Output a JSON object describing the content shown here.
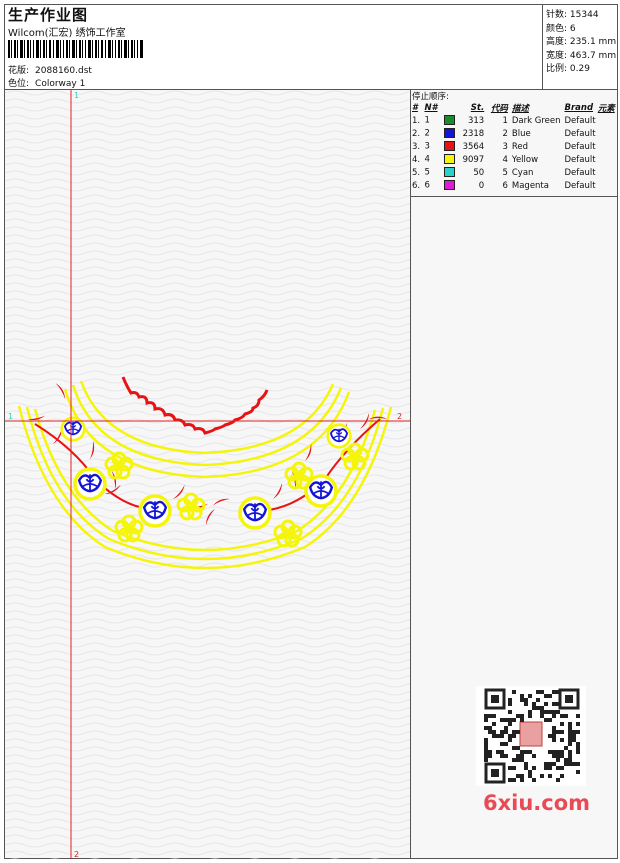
{
  "header": {
    "title": "生产作业图",
    "company": "Wilcom(汇宏) 绣饰工作室",
    "design_label": "花版:",
    "design_file": "2088160.dst",
    "colorway_label": "色位:",
    "colorway": "Colorway 1"
  },
  "stats": [
    {
      "label": "针数:",
      "value": "15344"
    },
    {
      "label": "颜色:",
      "value": "6"
    },
    {
      "label": "高度:",
      "value": "235.1 mm"
    },
    {
      "label": "宽度:",
      "value": "463.7 mm"
    },
    {
      "label": "比例:",
      "value": "0.29"
    }
  ],
  "stop_panel": {
    "title": "停止顺序:",
    "columns": [
      "#",
      "N#",
      "St.",
      "代码",
      "描述",
      "Brand",
      "元素"
    ],
    "rows": [
      {
        "num": "1.",
        "n": "1",
        "color": "#1e8a2e",
        "st": "313",
        "code": "1",
        "desc": "Dark Green",
        "brand": "Default"
      },
      {
        "num": "2.",
        "n": "2",
        "color": "#1414d8",
        "st": "2318",
        "code": "2",
        "desc": "Blue",
        "brand": "Default"
      },
      {
        "num": "3.",
        "n": "3",
        "color": "#e81414",
        "st": "3564",
        "code": "3",
        "desc": "Red",
        "brand": "Default"
      },
      {
        "num": "4.",
        "n": "4",
        "color": "#f5f50a",
        "st": "9097",
        "code": "4",
        "desc": "Yellow",
        "brand": "Default"
      },
      {
        "num": "5.",
        "n": "5",
        "color": "#2ad3c8",
        "st": "50",
        "code": "5",
        "desc": "Cyan",
        "brand": "Default"
      },
      {
        "num": "6.",
        "n": "6",
        "color": "#e11ad8",
        "st": "0",
        "code": "6",
        "desc": "Magenta",
        "brand": "Default"
      }
    ]
  },
  "guides": {
    "v_top": "1",
    "v_bottom": "2",
    "h_left": "1",
    "h_right": "2"
  },
  "watermark": {
    "text": "6xiu.com"
  },
  "colors": {
    "yellow": "#f5f50a",
    "blue": "#1414d8",
    "red": "#e81414",
    "guide": "#e02020"
  }
}
